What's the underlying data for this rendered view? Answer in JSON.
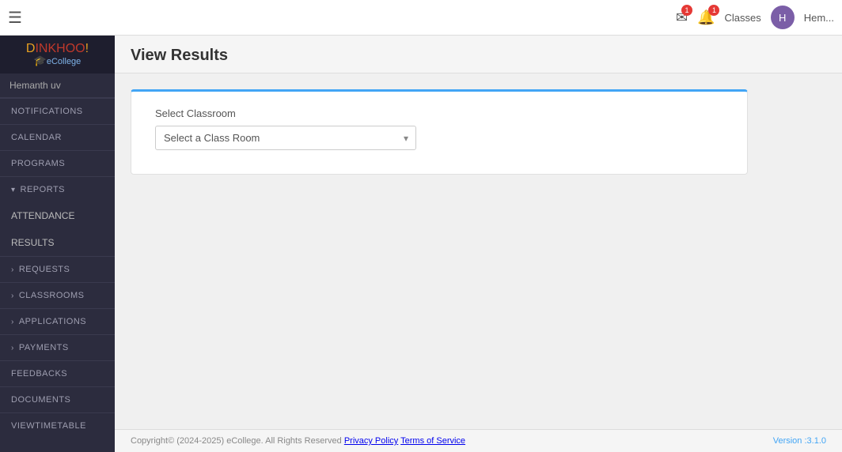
{
  "topNav": {
    "hamburgerIcon": "☰",
    "emailIcon": "✉",
    "emailBadge": "1",
    "bellIcon": "🔔",
    "bellBadge": "1",
    "classesLabel": "Classes",
    "usernameNav": "Hem...",
    "avatarInitial": "H"
  },
  "sidebar": {
    "logoTop": "DINKHOO!",
    "logoD": "D",
    "logoInkhoo": "INKHOO",
    "logoExcl": "!",
    "logoSub": "eCollege",
    "username": "Hemanth uv",
    "items": [
      {
        "label": "NOTIFICATIONS",
        "type": "link",
        "name": "notifications"
      },
      {
        "label": "CALENDAR",
        "type": "link",
        "name": "calendar"
      },
      {
        "label": "PROGRAMS",
        "type": "link",
        "name": "programs"
      },
      {
        "label": "REPORTS",
        "type": "collapsible",
        "name": "reports",
        "expanded": true
      },
      {
        "label": "ATTENDANCE",
        "type": "subitem",
        "name": "attendance"
      },
      {
        "label": "RESULTS",
        "type": "subitem",
        "name": "results"
      },
      {
        "label": "REQUESTS",
        "type": "collapsible",
        "name": "requests",
        "expanded": false
      },
      {
        "label": "CLASSROOMS",
        "type": "collapsible",
        "name": "classrooms",
        "expanded": false
      },
      {
        "label": "APPLICATIONS",
        "type": "collapsible",
        "name": "applications",
        "expanded": false
      },
      {
        "label": "PAYMENTS",
        "type": "collapsible",
        "name": "payments",
        "expanded": false
      },
      {
        "label": "FEEDBACKS",
        "type": "link",
        "name": "feedbacks"
      },
      {
        "label": "DOCUMENTS",
        "type": "link",
        "name": "documents"
      },
      {
        "label": "ViewTimeTable",
        "type": "link",
        "name": "view-timetable"
      }
    ]
  },
  "content": {
    "pageTitle": "View Results",
    "card": {
      "selectLabel": "Select Classroom",
      "selectPlaceholder": "Select a Class Room"
    }
  },
  "footer": {
    "copyright": "Copyright© (2024-2025) eCollege. All Rights Reserved",
    "privacyPolicy": "Privacy Policy",
    "termsOfService": "Terms of Service",
    "version": "Version :3.1.0"
  }
}
